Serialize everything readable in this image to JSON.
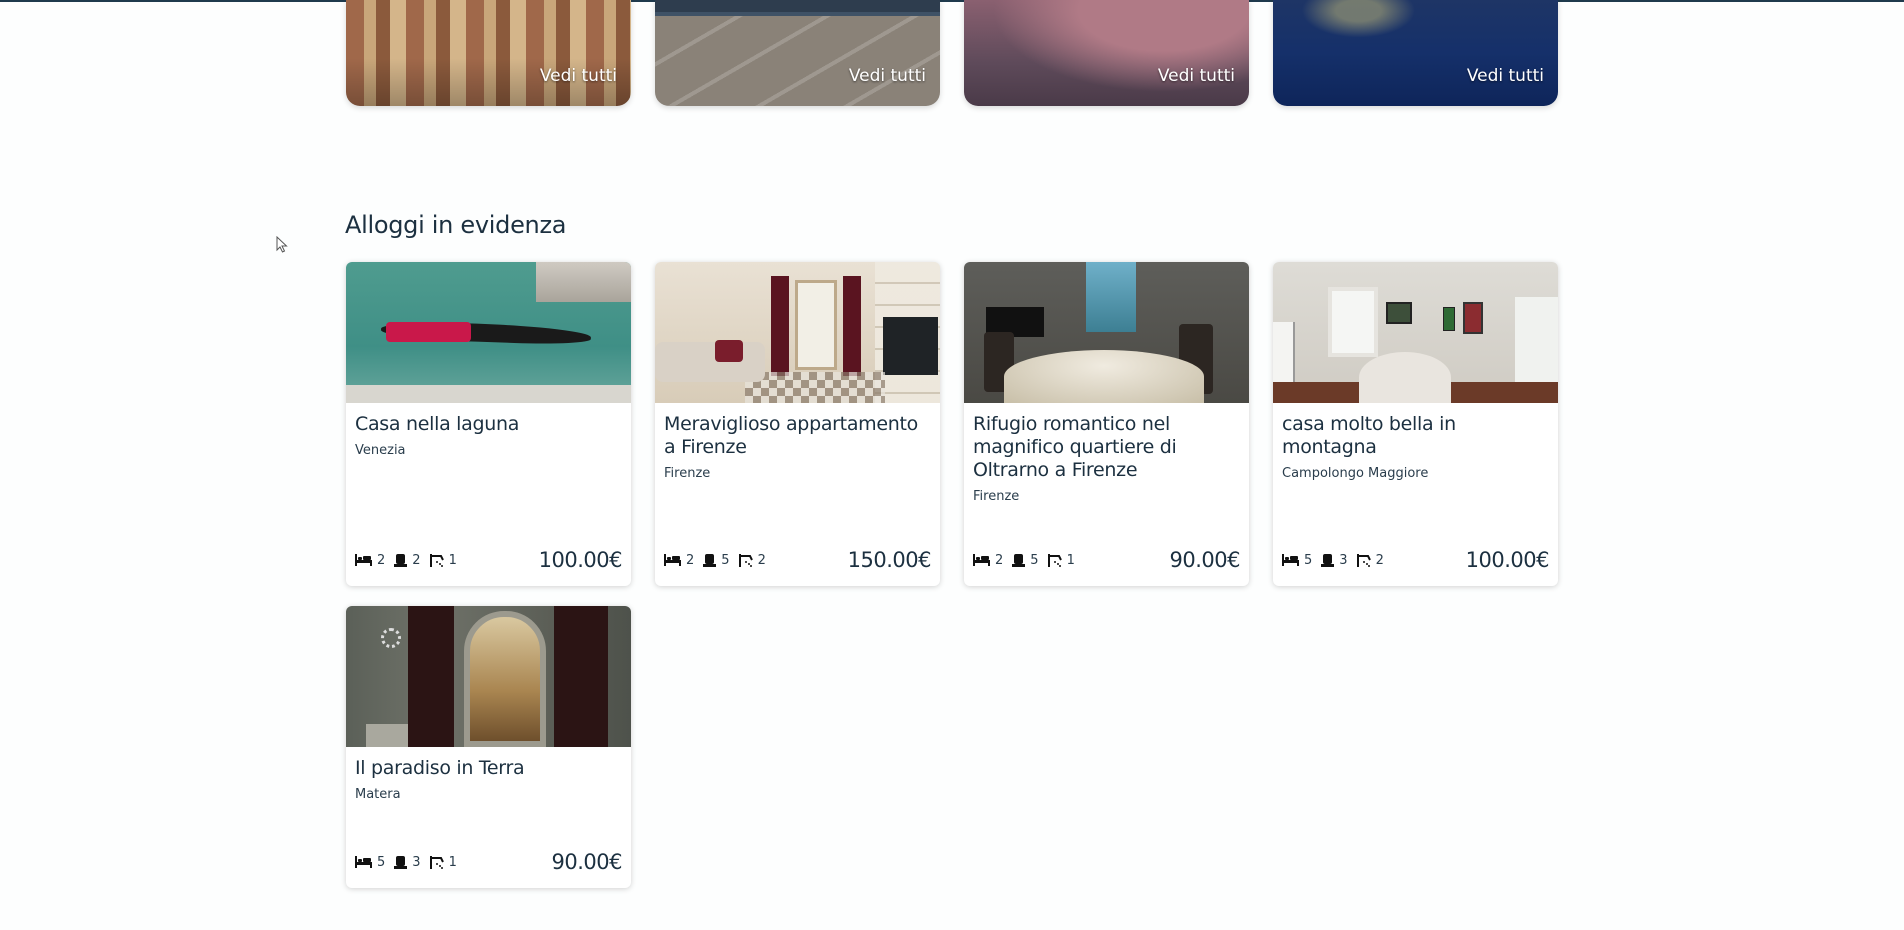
{
  "cities": [
    {
      "cta": "Vedi tutti"
    },
    {
      "cta": "Vedi tutti"
    },
    {
      "cta": "Vedi tutti"
    },
    {
      "cta": "Vedi tutti"
    }
  ],
  "featured": {
    "title": "Alloggi in evidenza",
    "listings": [
      {
        "title": "Casa nella laguna",
        "location": "Venezia",
        "beds": "2",
        "guests": "2",
        "baths": "1",
        "price": "100.00€"
      },
      {
        "title": "Meraviglioso appartamento a Firenze",
        "location": "Firenze",
        "beds": "2",
        "guests": "5",
        "baths": "2",
        "price": "150.00€"
      },
      {
        "title": "Rifugio romantico nel magnifico quartiere di Oltrarno a Firenze",
        "location": "Firenze",
        "beds": "2",
        "guests": "5",
        "baths": "1",
        "price": "90.00€"
      },
      {
        "title": "casa molto bella in montagna",
        "location": "Campolongo Maggiore",
        "beds": "5",
        "guests": "3",
        "baths": "2",
        "price": "100.00€"
      },
      {
        "title": "Il paradiso in Terra",
        "location": "Matera",
        "beds": "5",
        "guests": "3",
        "baths": "1",
        "price": "90.00€"
      }
    ]
  },
  "icons": {
    "beds": "bed-icon",
    "guests": "person-icon",
    "baths": "shower-icon",
    "cursor": "mouse-cursor-icon"
  }
}
